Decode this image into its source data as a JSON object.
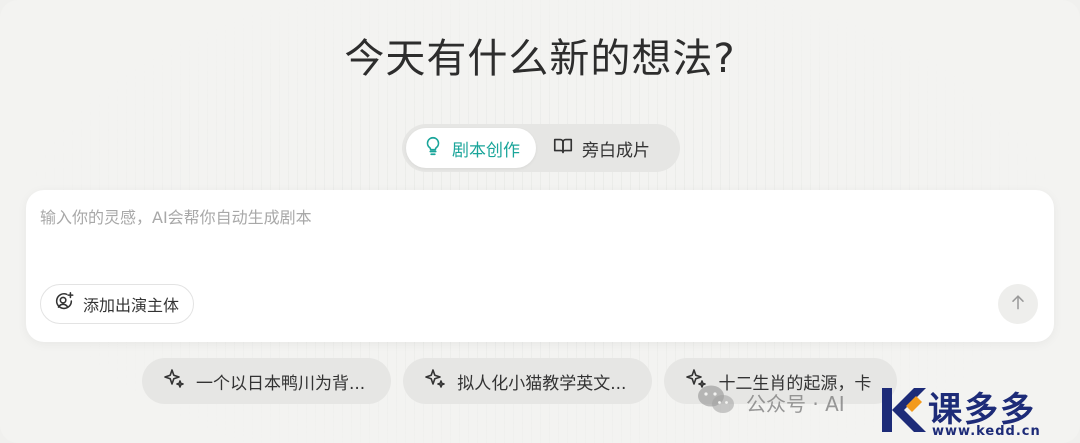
{
  "page": {
    "title": "今天有什么新的想法?"
  },
  "mode_switch": {
    "tabs": [
      {
        "label": "剧本创作",
        "icon": "lightbulb-icon",
        "active": true
      },
      {
        "label": "旁白成片",
        "icon": "book-icon",
        "active": false
      }
    ]
  },
  "prompt": {
    "placeholder": "输入你的灵感，AI会帮你自动生成剧本",
    "value": ""
  },
  "toolbar": {
    "add_actor_label": "添加出演主体",
    "send_icon": "arrow-up-icon"
  },
  "suggestions": [
    {
      "label": "一个以日本鸭川为背...",
      "icon": "sparkle-icon"
    },
    {
      "label": "拟人化小猫教学英文...",
      "icon": "sparkle-icon"
    },
    {
      "label": "十二生肖的起源，卡",
      "icon": "sparkle-icon"
    }
  ],
  "watermark": {
    "text": "公众号 · AI"
  },
  "brand": {
    "name": "课多多",
    "url": "www.kedd.cn"
  },
  "colors": {
    "accent": "#1aa59a",
    "brand": "#1d2b78",
    "brand_accent": "#f39a1c"
  }
}
